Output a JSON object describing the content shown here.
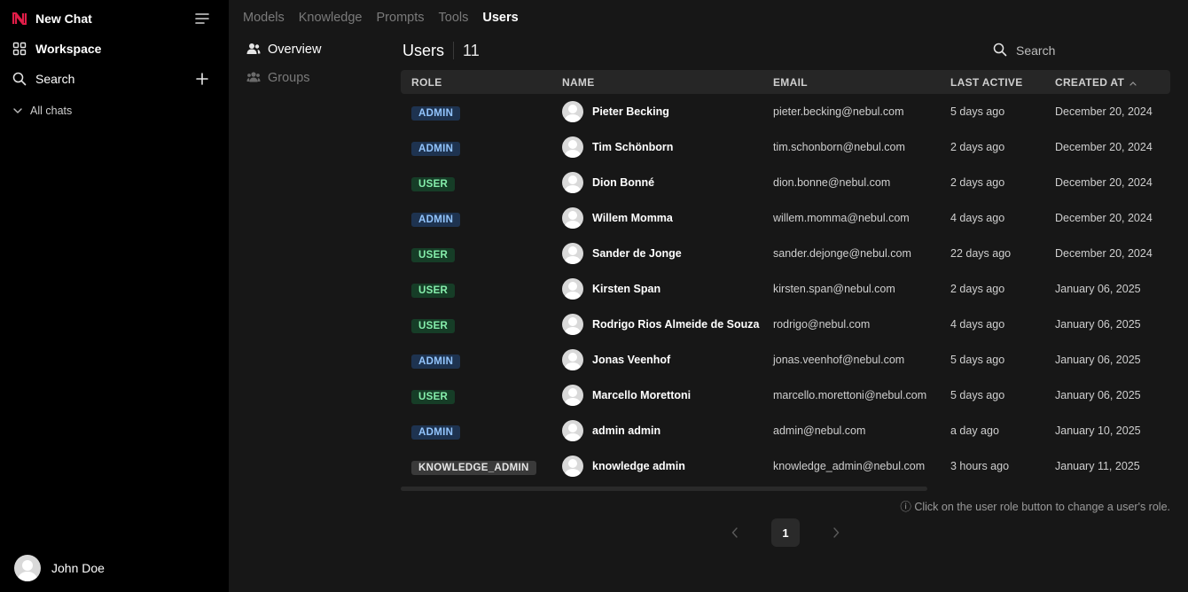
{
  "sidebar": {
    "new_chat": "New Chat",
    "workspace": "Workspace",
    "search": "Search",
    "all_chats": "All chats",
    "user_name": "John Doe",
    "brand_color": "#e11d48"
  },
  "topnav": {
    "models": "Models",
    "knowledge": "Knowledge",
    "prompts": "Prompts",
    "tools": "Tools",
    "users": "Users"
  },
  "subnav": {
    "overview": "Overview",
    "groups": "Groups"
  },
  "main": {
    "title": "Users",
    "count": "11",
    "search_placeholder": "Search"
  },
  "table": {
    "headers": {
      "role": "ROLE",
      "name": "NAME",
      "email": "EMAIL",
      "last_active": "LAST ACTIVE",
      "created_at": "CREATED AT"
    },
    "rows": [
      {
        "role": "ADMIN",
        "name": "Pieter Becking",
        "email": "pieter.becking@nebul.com",
        "last_active": "5 days ago",
        "created_at": "December 20, 2024"
      },
      {
        "role": "ADMIN",
        "name": "Tim Schönborn",
        "email": "tim.schonborn@nebul.com",
        "last_active": "2 days ago",
        "created_at": "December 20, 2024"
      },
      {
        "role": "USER",
        "name": "Dion Bonné",
        "email": "dion.bonne@nebul.com",
        "last_active": "2 days ago",
        "created_at": "December 20, 2024"
      },
      {
        "role": "ADMIN",
        "name": "Willem Momma",
        "email": "willem.momma@nebul.com",
        "last_active": "4 days ago",
        "created_at": "December 20, 2024"
      },
      {
        "role": "USER",
        "name": "Sander de Jonge",
        "email": "sander.dejonge@nebul.com",
        "last_active": "22 days ago",
        "created_at": "December 20, 2024"
      },
      {
        "role": "USER",
        "name": "Kirsten Span",
        "email": "kirsten.span@nebul.com",
        "last_active": "2 days ago",
        "created_at": "January 06, 2025"
      },
      {
        "role": "USER",
        "name": "Rodrigo Rios Almeide de Souza",
        "email": "rodrigo@nebul.com",
        "last_active": "4 days ago",
        "created_at": "January 06, 2025"
      },
      {
        "role": "ADMIN",
        "name": "Jonas Veenhof",
        "email": "jonas.veenhof@nebul.com",
        "last_active": "5 days ago",
        "created_at": "January 06, 2025"
      },
      {
        "role": "USER",
        "name": "Marcello Morettoni",
        "email": "marcello.morettoni@nebul.com",
        "last_active": "5 days ago",
        "created_at": "January 06, 2025"
      },
      {
        "role": "ADMIN",
        "name": "admin admin",
        "email": "admin@nebul.com",
        "last_active": "a day ago",
        "created_at": "January 10, 2025"
      },
      {
        "role": "KNOWLEDGE_ADMIN",
        "name": "knowledge admin",
        "email": "knowledge_admin@nebul.com",
        "last_active": "3 hours ago",
        "created_at": "January 11, 2025"
      }
    ]
  },
  "footer": {
    "hint": "ⓘ Click on the user role button to change a user's role.",
    "current_page": "1"
  }
}
